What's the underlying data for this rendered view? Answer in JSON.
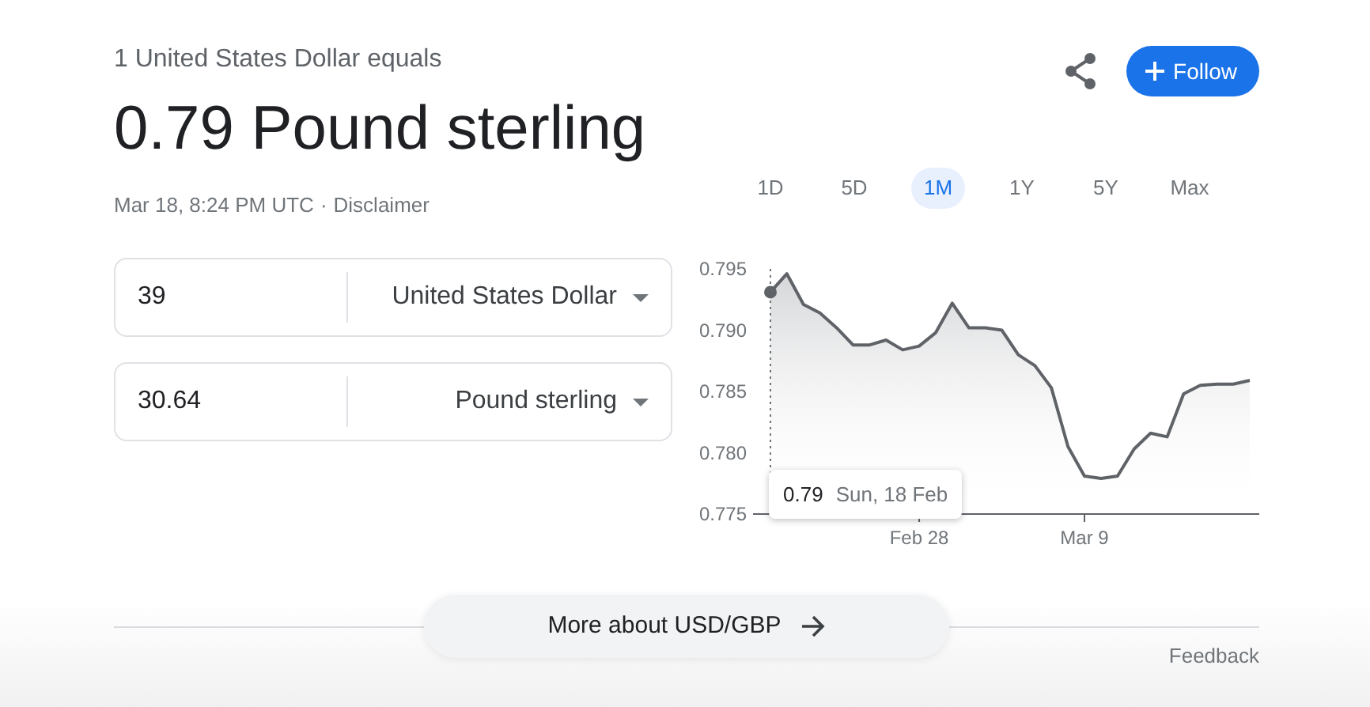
{
  "header": {
    "subtitle": "1 United States Dollar equals",
    "result": "0.79 Pound sterling",
    "timestamp": "Mar 18, 8:24 PM UTC",
    "separator": "·",
    "disclaimer": "Disclaimer",
    "follow_label": "Follow"
  },
  "converter": [
    {
      "amount": "39",
      "currency": "United States Dollar"
    },
    {
      "amount": "30.64",
      "currency": "Pound sterling"
    }
  ],
  "periods": [
    {
      "label": "1D",
      "selected": false
    },
    {
      "label": "5D",
      "selected": false
    },
    {
      "label": "1M",
      "selected": true
    },
    {
      "label": "1Y",
      "selected": false
    },
    {
      "label": "5Y",
      "selected": false
    },
    {
      "label": "Max",
      "selected": false
    }
  ],
  "chart": {
    "chart_data": {
      "type": "area",
      "categories": [
        null,
        null,
        null,
        null,
        null,
        null,
        null,
        null,
        null,
        "Feb 28",
        null,
        null,
        null,
        null,
        null,
        null,
        null,
        null,
        null,
        "Mar 9",
        null,
        null,
        null,
        null,
        null,
        null,
        null,
        null,
        null,
        null
      ],
      "series": [
        {
          "color": "#5f6368",
          "values": [
            0.7931,
            0.7946,
            0.7921,
            0.7914,
            0.7902,
            0.7888,
            0.7888,
            0.7892,
            0.7884,
            0.7887,
            0.7898,
            0.7922,
            0.7902,
            0.7902,
            0.79,
            0.788,
            0.7871,
            0.7853,
            0.7805,
            0.7781,
            0.7779,
            0.7781,
            0.7803,
            0.7816,
            0.7813,
            0.7848,
            0.7855,
            0.7856,
            0.7856,
            0.7859
          ]
        }
      ],
      "ylim": [
        0.775,
        0.795
      ],
      "yticks": [
        {
          "value": 0.775,
          "label": "0.775"
        },
        {
          "value": 0.78,
          "label": "0.780"
        },
        {
          "value": 0.785,
          "label": "0.785"
        },
        {
          "value": 0.79,
          "label": "0.790"
        },
        {
          "value": 0.795,
          "label": "0.795"
        }
      ]
    },
    "tooltip": {
      "value": "0.79",
      "date": "Sun, 18 Feb"
    }
  },
  "more_link": "More about USD/GBP",
  "feedback": "Feedback"
}
